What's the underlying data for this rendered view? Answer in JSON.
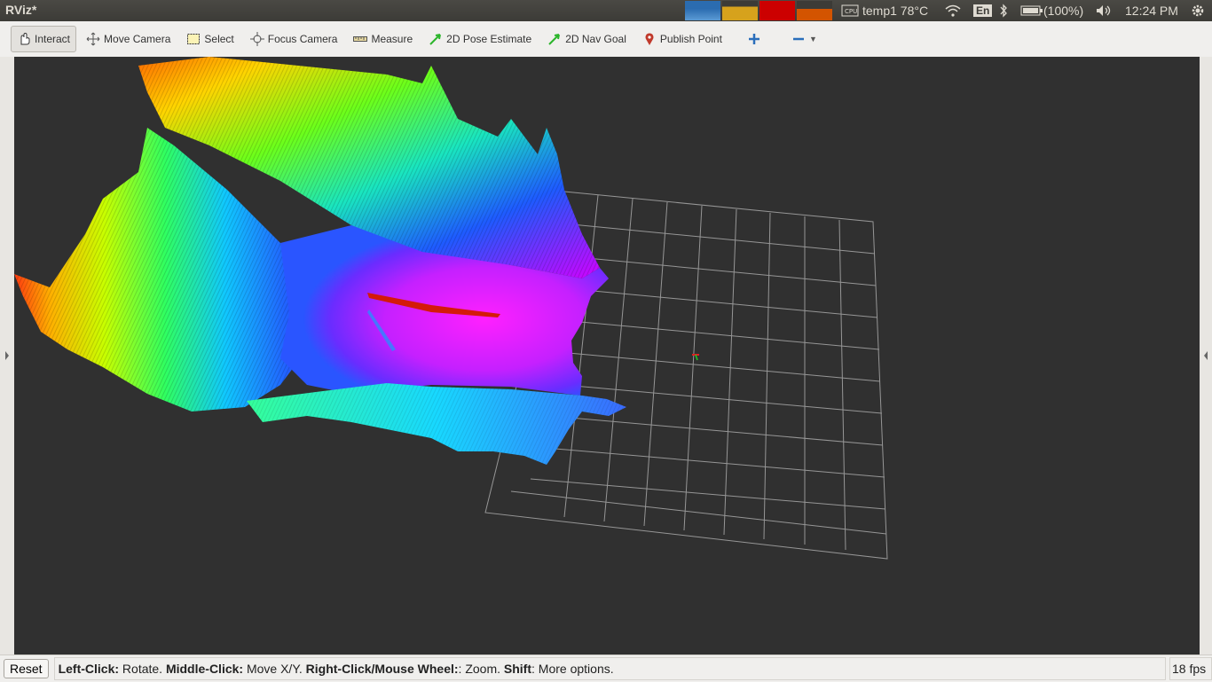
{
  "app": {
    "title": "RViz*"
  },
  "tray": {
    "temp": "temp1 78°C",
    "lang": "En",
    "battery": "(100%)",
    "time": "12:24 PM"
  },
  "toolbar": {
    "interact": "Interact",
    "move_camera": "Move Camera",
    "select": "Select",
    "focus_camera": "Focus Camera",
    "measure": "Measure",
    "pose_estimate": "2D Pose Estimate",
    "nav_goal": "2D Nav Goal",
    "publish_point": "Publish Point"
  },
  "status": {
    "reset": "Reset",
    "left_click_key": "Left-Click:",
    "left_click_val": " Rotate. ",
    "middle_click_key": "Middle-Click:",
    "middle_click_val": " Move X/Y. ",
    "right_click_key": "Right-Click/Mouse Wheel:",
    "right_click_val": ": Zoom. ",
    "shift_key": "Shift",
    "shift_val": ": More options.",
    "fps": "18 fps"
  },
  "colors": {
    "accent_red": "#cc0000",
    "pose_green": "#2bb52b",
    "pin_red": "#c0392b",
    "plus_blue": "#2a6ebb"
  }
}
